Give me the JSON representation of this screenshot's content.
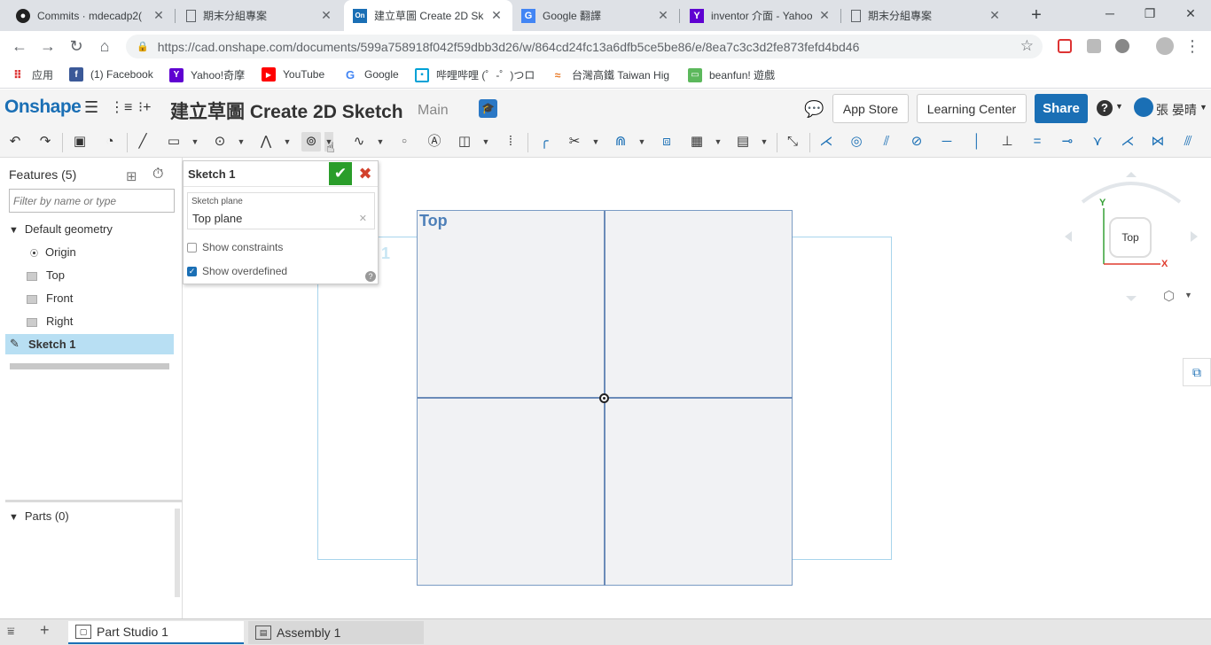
{
  "browser": {
    "tabs": [
      {
        "title": "Commits · mdecadp2(",
        "icon": "github-icon",
        "active": false
      },
      {
        "title": "期末分組專案",
        "icon": "document-icon",
        "active": false
      },
      {
        "title": "建立草圖 Create 2D Sk",
        "icon": "onshape-icon",
        "active": true
      },
      {
        "title": "Google 翻譯",
        "icon": "google-translate-icon",
        "active": false
      },
      {
        "title": "inventor 介面 - Yahoo",
        "icon": "yahoo-icon",
        "active": false
      },
      {
        "title": "期末分組專案",
        "icon": "document-icon",
        "active": false
      }
    ],
    "url": "https://cad.onshape.com/documents/599a758918f042f59dbb3d26/w/864cd24fc13a6dfb5ce5be86/e/8ea7c3c3d2fe873fefd4bd46",
    "bookmarks": [
      {
        "label": "应用",
        "icon": "apps-icon"
      },
      {
        "label": "(1) Facebook",
        "icon": "facebook-icon"
      },
      {
        "label": "Yahoo!奇摩",
        "icon": "yahoo-icon"
      },
      {
        "label": "YouTube",
        "icon": "youtube-icon"
      },
      {
        "label": "Google",
        "icon": "google-icon"
      },
      {
        "label": "哔哩哔哩 (゜-゜)つロ",
        "icon": "bilibili-icon"
      },
      {
        "label": "台灣高鐵 Taiwan Hig",
        "icon": "thsr-icon"
      },
      {
        "label": "beanfun! 遊戲",
        "icon": "beanfun-icon"
      }
    ]
  },
  "onshape": {
    "logo": "Onshape",
    "document_title": "建立草圖 Create 2D Sketch",
    "branch": "Main",
    "app_store": "App Store",
    "learning_center": "Learning Center",
    "share": "Share",
    "user": "張 晏晴"
  },
  "feature_panel": {
    "title": "Features (5)",
    "filter_placeholder": "Filter by name or type",
    "default_geometry": "Default geometry",
    "items": [
      "Origin",
      "Top",
      "Front",
      "Right"
    ],
    "sketch": "Sketch 1",
    "parts": "Parts (0)"
  },
  "sketch_dialog": {
    "title": "Sketch 1",
    "plane_label": "Sketch plane",
    "plane_value": "Top plane",
    "show_constraints": "Show constraints",
    "show_overdefined": "Show overdefined"
  },
  "viewport": {
    "plane_label": "Top",
    "sketch_label": "Sketch 1",
    "cube_face": "Top",
    "axis_y": "Y",
    "axis_x": "X"
  },
  "bottom_tabs": [
    {
      "label": "Part Studio 1",
      "active": true
    },
    {
      "label": "Assembly 1",
      "active": false
    }
  ],
  "colors": {
    "brand": "#1a6fb5",
    "confirm": "#2a9d2a",
    "cancel": "#d2412c",
    "selected_row": "#b8dff3"
  }
}
